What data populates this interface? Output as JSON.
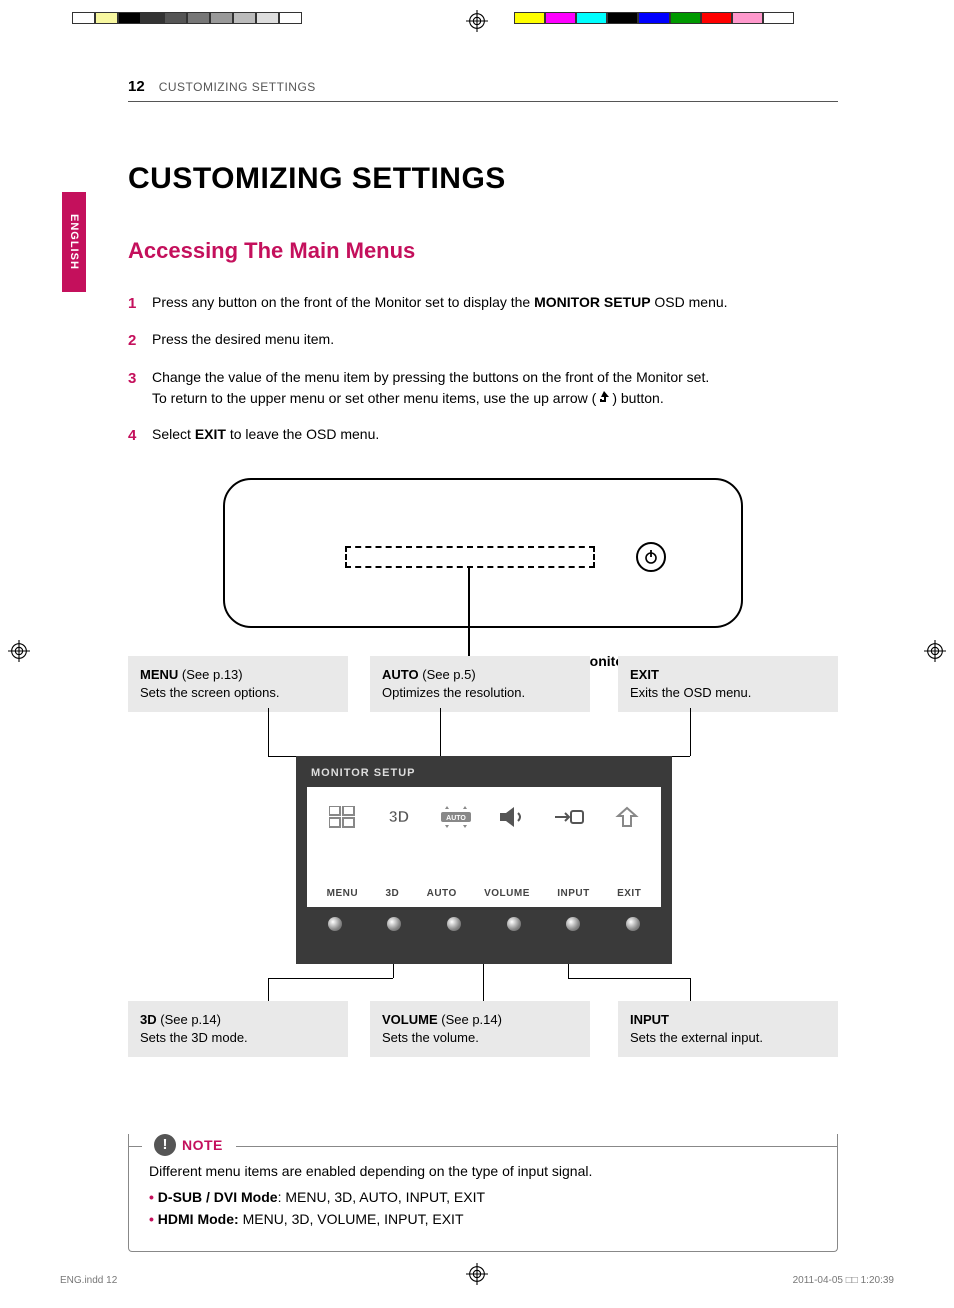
{
  "lang_tab": "ENGLISH",
  "running_head": {
    "page_num": "12",
    "section": "CUSTOMIZING SETTINGS"
  },
  "title": "CUSTOMIZING SETTINGS",
  "subtitle": "Accessing The Main Menus",
  "steps": [
    {
      "num": "1",
      "pre": "Press any button on the front of the Monitor set to display the ",
      "bold": "MONITOR SETUP",
      "post": " OSD menu."
    },
    {
      "num": "2",
      "pre": "Press the desired menu item.",
      "bold": "",
      "post": ""
    },
    {
      "num": "3",
      "pre": "Change the value of the menu item by pressing the buttons on the front of the Monitor set.",
      "bold": "",
      "post": "",
      "line2_pre": "To return to the upper menu or set other menu items, use the up arrow (",
      "line2_post": ") button."
    },
    {
      "num": "4",
      "pre": "Select ",
      "bold": "EXIT",
      "post": " to leave the OSD menu."
    }
  ],
  "diagram": {
    "callout": "Monitor set Buttons"
  },
  "info_boxes": {
    "menu": {
      "title": "MENU",
      "ref": "(See p.13)",
      "desc": "Sets the screen options."
    },
    "auto": {
      "title": "AUTO",
      "ref": "(See p.5)",
      "desc": "Optimizes the resolution."
    },
    "exit": {
      "title": "EXIT",
      "ref": "",
      "desc": "Exits the OSD menu."
    },
    "threeD": {
      "title": "3D",
      "ref": "(See p.14)",
      "desc": "Sets the 3D mode."
    },
    "volume": {
      "title": "VOLUME",
      "ref": "(See p.14)",
      "desc": "Sets the volume."
    },
    "input": {
      "title": "INPUT",
      "ref": "",
      "desc": "Sets the external input."
    }
  },
  "osd": {
    "header": "MONITOR SETUP",
    "labels": [
      "MENU",
      "3D",
      "AUTO",
      "VOLUME",
      "INPUT",
      "EXIT"
    ]
  },
  "note": {
    "label": "NOTE",
    "intro": "Different menu items are enabled depending on the type of input signal.",
    "bullets": [
      {
        "bold": "D-SUB / DVI Mode",
        "rest": ": MENU, 3D, AUTO, INPUT, EXIT"
      },
      {
        "bold": "HDMI Mode:",
        "rest": " MENU, 3D, VOLUME, INPUT, EXIT"
      }
    ]
  },
  "footer": {
    "left": "ENG.indd   12",
    "right": "2011-04-05   □□ 1:20:39"
  },
  "colors": {
    "strip_left": [
      "#fff",
      "#f7f7a0",
      "#000",
      "#333",
      "#555",
      "#777",
      "#999",
      "#bbb",
      "#ddd",
      "#fff"
    ],
    "strip_right": [
      "#ffff00",
      "#ff00ff",
      "#00ffff",
      "#000",
      "#0000ff",
      "#009900",
      "#ff0000",
      "#ff99cc",
      "#fff"
    ]
  }
}
